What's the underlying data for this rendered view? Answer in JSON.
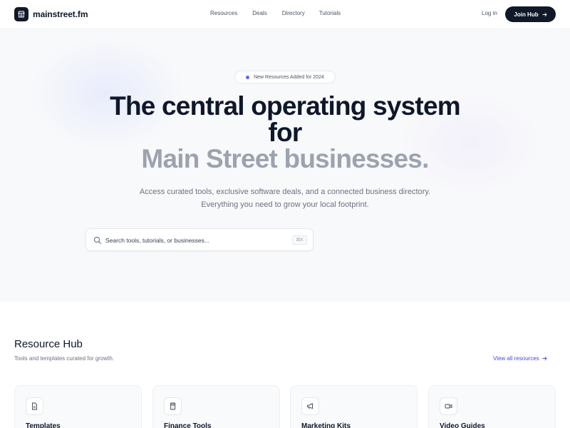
{
  "nav": {
    "brand": "mainstreet.fm",
    "brand_icon": "storefront-icon",
    "links": [
      "Resources",
      "Deals",
      "Directory",
      "Tutorials"
    ],
    "login": "Log in",
    "join": "Join Hub"
  },
  "hero": {
    "badge": "New Resources Added for 2024",
    "badge_dot_color": "#6366f1",
    "headline_line1": "The central operating system for",
    "headline_line2": "Main Street businesses.",
    "subtext": "Access curated tools, exclusive software deals, and a connected business directory. Everything you need to grow your local footprint.",
    "search_placeholder": "Search tools, tutorials, or businesses...",
    "search_shortcut": "⌘K"
  },
  "resource_hub": {
    "title": "Resource Hub",
    "subtitle": "Tools and templates curated for growth.",
    "view_all": "View all resources",
    "cards": [
      {
        "title": "Templates",
        "icon": "document-icon"
      },
      {
        "title": "Finance Tools",
        "icon": "calculator-icon"
      },
      {
        "title": "Marketing Kits",
        "icon": "megaphone-icon"
      },
      {
        "title": "Video Guides",
        "icon": "video-icon"
      }
    ]
  },
  "colors": {
    "primary_dark": "#111827",
    "accent": "#4f46e5",
    "muted_headline": "#9ca3af",
    "hero_bg": "#f8f9fb"
  }
}
